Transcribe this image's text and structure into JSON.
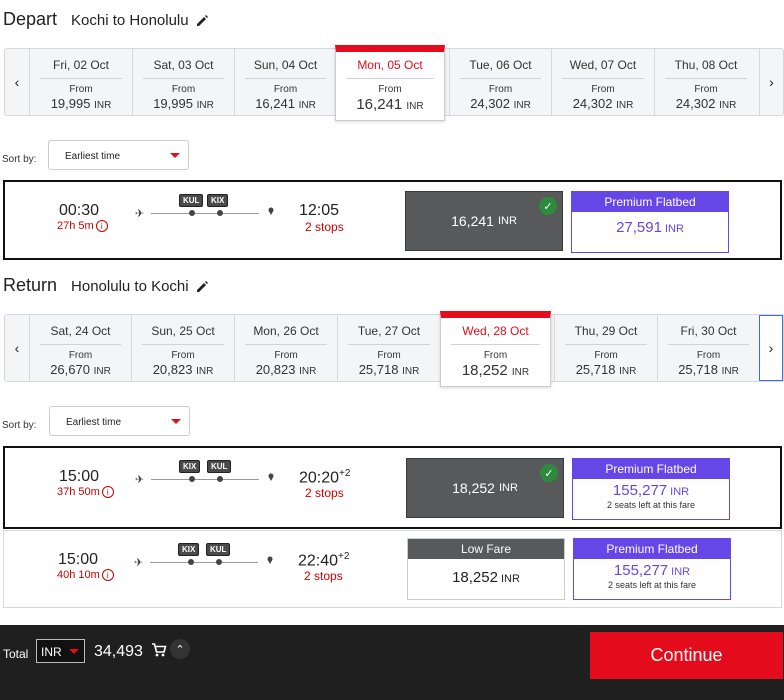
{
  "depart": {
    "title": "Depart",
    "route": "Kochi to Honolulu",
    "dates": [
      {
        "date": "Fri, 02 Oct",
        "from": "From",
        "price": "19,995",
        "currency": "INR"
      },
      {
        "date": "Sat, 03 Oct",
        "from": "From",
        "price": "19,995",
        "currency": "INR"
      },
      {
        "date": "Sun, 04 Oct",
        "from": "From",
        "price": "16,241",
        "currency": "INR"
      },
      {
        "date": "Mon, 05 Oct",
        "from": "From",
        "price": "16,241",
        "currency": "INR"
      },
      {
        "date": "Tue, 06 Oct",
        "from": "From",
        "price": "24,302",
        "currency": "INR"
      },
      {
        "date": "Wed, 07 Oct",
        "from": "From",
        "price": "24,302",
        "currency": "INR"
      },
      {
        "date": "Thu, 08 Oct",
        "from": "From",
        "price": "24,302",
        "currency": "INR"
      }
    ],
    "selected_index": 3,
    "sort_label": "Sort by:",
    "sort_value": "Earliest time",
    "flights": [
      {
        "dep_time": "00:30",
        "duration": "27h 5m",
        "arr_time": "12:05",
        "day_offset": "",
        "stops": "2 stops",
        "airports": [
          "KUL",
          "KIX"
        ],
        "fare_price": "16,241",
        "fare_currency": "INR",
        "premium_label": "Premium Flatbed",
        "premium_price": "27,591",
        "premium_currency": "INR"
      }
    ]
  },
  "return": {
    "title": "Return",
    "route": "Honolulu to Kochi",
    "dates": [
      {
        "date": "Sat, 24 Oct",
        "from": "From",
        "price": "26,670",
        "currency": "INR"
      },
      {
        "date": "Sun, 25 Oct",
        "from": "From",
        "price": "20,823",
        "currency": "INR"
      },
      {
        "date": "Mon, 26 Oct",
        "from": "From",
        "price": "20,823",
        "currency": "INR"
      },
      {
        "date": "Tue, 27 Oct",
        "from": "From",
        "price": "25,718",
        "currency": "INR"
      },
      {
        "date": "Wed, 28 Oct",
        "from": "From",
        "price": "18,252",
        "currency": "INR"
      },
      {
        "date": "Thu, 29 Oct",
        "from": "From",
        "price": "25,718",
        "currency": "INR"
      },
      {
        "date": "Fri, 30 Oct",
        "from": "From",
        "price": "25,718",
        "currency": "INR"
      }
    ],
    "selected_index": 4,
    "sort_label": "Sort by:",
    "sort_value": "Earliest time",
    "flights": [
      {
        "dep_time": "15:00",
        "duration": "37h 50m",
        "arr_time": "20:20",
        "day_offset": "+2",
        "stops": "2 stops",
        "airports": [
          "KIX",
          "KUL"
        ],
        "fare_price": "18,252",
        "fare_currency": "INR",
        "premium_label": "Premium Flatbed",
        "premium_price": "155,277",
        "premium_currency": "INR",
        "seats_left": "2 seats left at this fare"
      },
      {
        "dep_time": "15:00",
        "duration": "40h 10m",
        "arr_time": "22:40",
        "day_offset": "+2",
        "stops": "2 stops",
        "airports": [
          "KIX",
          "KUL"
        ],
        "low_label": "Low Fare",
        "fare_price": "18,252",
        "fare_currency": "INR",
        "premium_label": "Premium Flatbed",
        "premium_price": "155,277",
        "premium_currency": "INR",
        "seats_left": "2 seats left at this fare"
      }
    ]
  },
  "footer": {
    "total_label": "Total",
    "currency": "INR",
    "total": "34,493",
    "continue_label": "Continue"
  },
  "colors": {
    "accent_red": "#e40c1c",
    "premium_purple": "#6546e6",
    "fare_dark": "#58595b",
    "check_green": "#2e8b3e"
  }
}
